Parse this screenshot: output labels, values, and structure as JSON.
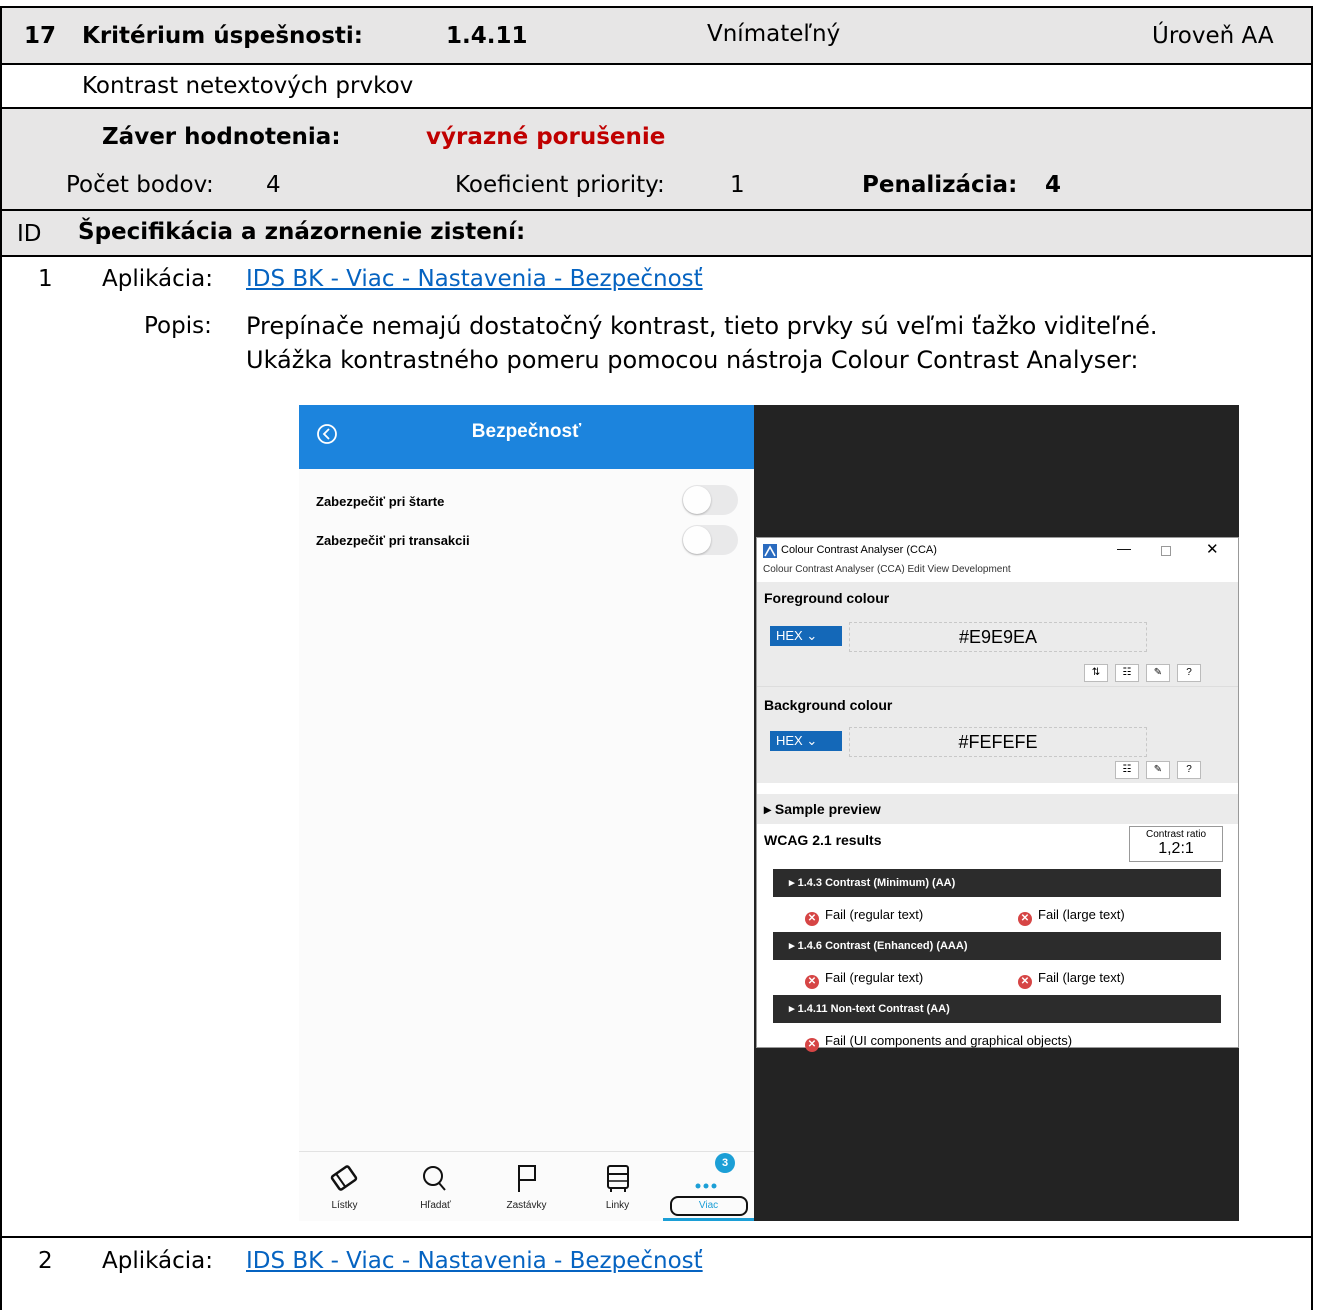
{
  "criterion": {
    "number": "17",
    "label": "Kritérium úspešnosti:",
    "code": "1.4.11",
    "principle": "Vnímateľný",
    "level": "Úroveň AA",
    "name": "Kontrast netextových prvkov"
  },
  "evaluation": {
    "conclusion_label": "Záver hodnotenia:",
    "conclusion_value": "výrazné porušenie",
    "points_label": "Počet bodov:",
    "points_value": "4",
    "priority_label": "Koeficient priority:",
    "priority_value": "1",
    "penalty_label": "Penalizácia:",
    "penalty_value": "4"
  },
  "findings_header": {
    "id_label": "ID",
    "title": "Špecifikácia a znázornenie zistení:"
  },
  "findings": [
    {
      "id": "1",
      "app_label": "Aplikácia:",
      "app_link": "IDS BK - Viac - Nastavenia - Bezpečnosť",
      "desc_label": "Popis:",
      "desc_line1": "Prepínače nemajú dostatočný kontrast, tieto prvky sú veľmi ťažko viditeľné.",
      "desc_line2": "Ukážka kontrastného pomeru pomocou nástroja Colour Contrast Analyser:"
    },
    {
      "id": "2",
      "app_label": "Aplikácia:",
      "app_link": "IDS BK - Viac - Nastavenia - Bezpečnosť"
    }
  ],
  "screenshot": {
    "phone": {
      "title": "Bezpečnosť",
      "settings": [
        "Zabezpečiť pri štarte",
        "Zabezpečiť pri transakcii"
      ],
      "tabs": [
        "Lístky",
        "Hľadať",
        "Zastávky",
        "Linky",
        "Viac"
      ],
      "badge": "3",
      "accent": "#1c84dd"
    },
    "cca": {
      "window_title": "Colour Contrast Analyser (CCA)",
      "menu": "Colour Contrast Analyser (CCA)   Edit   View   Development",
      "foreground_label": "Foreground colour",
      "foreground_format": "HEX",
      "foreground_value": "#E9E9EA",
      "background_label": "Background colour",
      "background_format": "HEX",
      "background_value": "#FEFEFE",
      "sample_preview": "Sample preview",
      "results_label": "WCAG 2.1 results",
      "contrast_ratio_label": "Contrast ratio",
      "contrast_ratio_value": "1,2:1",
      "r1_title": "1.4.3 Contrast (Minimum) (AA)",
      "r2_title": "1.4.6 Contrast (Enhanced) (AAA)",
      "r3_title": "1.4.11 Non-text Contrast (AA)",
      "fail_regular": "Fail (regular text)",
      "fail_large": "Fail (large text)",
      "fail_ui": "Fail (UI components and graphical objects)"
    }
  }
}
